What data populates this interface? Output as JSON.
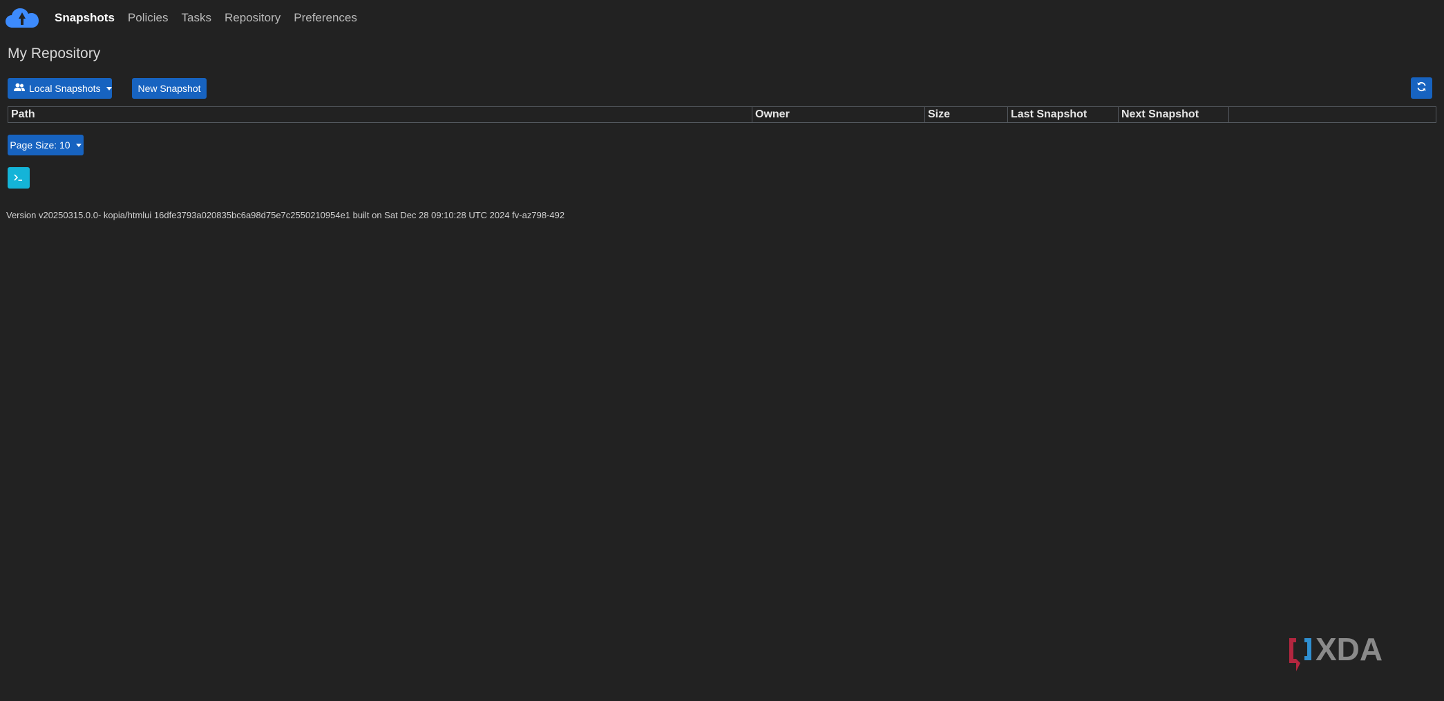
{
  "nav": {
    "logo_icon": "cloud-logo-icon",
    "items": [
      {
        "label": "Snapshots",
        "active": true
      },
      {
        "label": "Policies",
        "active": false
      },
      {
        "label": "Tasks",
        "active": false
      },
      {
        "label": "Repository",
        "active": false
      },
      {
        "label": "Preferences",
        "active": false
      }
    ]
  },
  "page": {
    "title": "My Repository"
  },
  "toolbar": {
    "local_snapshots_label": "Local Snapshots",
    "local_snapshots_icon": "users-icon",
    "new_snapshot_label": "New Snapshot",
    "refresh_icon": "refresh-icon"
  },
  "table": {
    "columns": [
      "Path",
      "Owner",
      "Size",
      "Last Snapshot",
      "Next Snapshot",
      ""
    ],
    "rows": []
  },
  "pagination": {
    "page_size_label": "Page Size: 10"
  },
  "terminal": {
    "icon": "terminal-icon"
  },
  "footer": {
    "version_text": "Version v20250315.0.0- kopia/htmlui 16dfe3793a020835bc6a98d75e7c2550210954e1 built on Sat Dec 28 09:10:28 UTC 2024 fv-az798-492"
  },
  "watermark": {
    "text": "XDA"
  },
  "colors": {
    "background": "#222222",
    "primary": "#1763c0",
    "info": "#14b4d8",
    "logo": "#3d8bfd"
  }
}
